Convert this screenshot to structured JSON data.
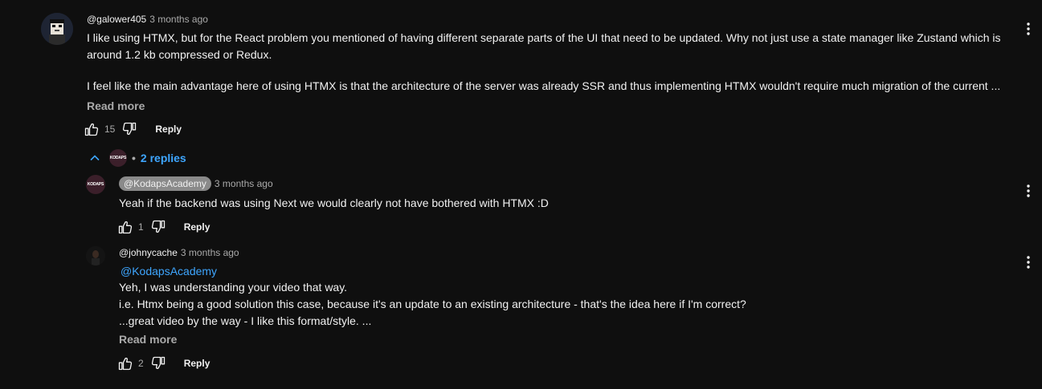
{
  "comment": {
    "handle": "@galower405",
    "time": "3 months ago",
    "line1": "I like using HTMX, but for the React problem you mentioned of having different separate parts of the UI that need to be updated. Why not just use a state manager like Zustand which is",
    "line2": "around 1.2 kb compressed or Redux.",
    "line3": "I feel like the main advantage here of using HTMX is that the architecture of the server was already SSR and thus implementing HTMX wouldn't require much migration of the current ...",
    "read_more": "Read more",
    "likes": "15",
    "reply_label": "Reply"
  },
  "replies_toggle": {
    "label": "2 replies",
    "dot": "•"
  },
  "replies": [
    {
      "avatar_text": "KODAPS",
      "handle": "@KodapsAcademy",
      "time": "3 months ago",
      "text": "Yeah if the backend was using Next we would clearly not have bothered with HTMX :D",
      "likes": "1",
      "reply_label": "Reply"
    },
    {
      "handle": "@johnycache",
      "time": "3 months ago",
      "mention": "@KodapsAcademy",
      "line1": "Yeh, I was understanding your video that way.",
      "line2": "i.e. Htmx being a good solution this case, because it's an update to an existing architecture - that's the idea here if I'm correct?",
      "line3": "...great video by the way - I like this format/style. ...",
      "read_more": "Read more",
      "likes": "2",
      "reply_label": "Reply"
    }
  ],
  "colors": {
    "background": "#0f0f0f",
    "link": "#3ea6ff",
    "secondary_text": "#aaaaaa"
  },
  "icons": [
    "like-icon",
    "dislike-icon",
    "more-vert-icon",
    "chevron-up-icon"
  ]
}
